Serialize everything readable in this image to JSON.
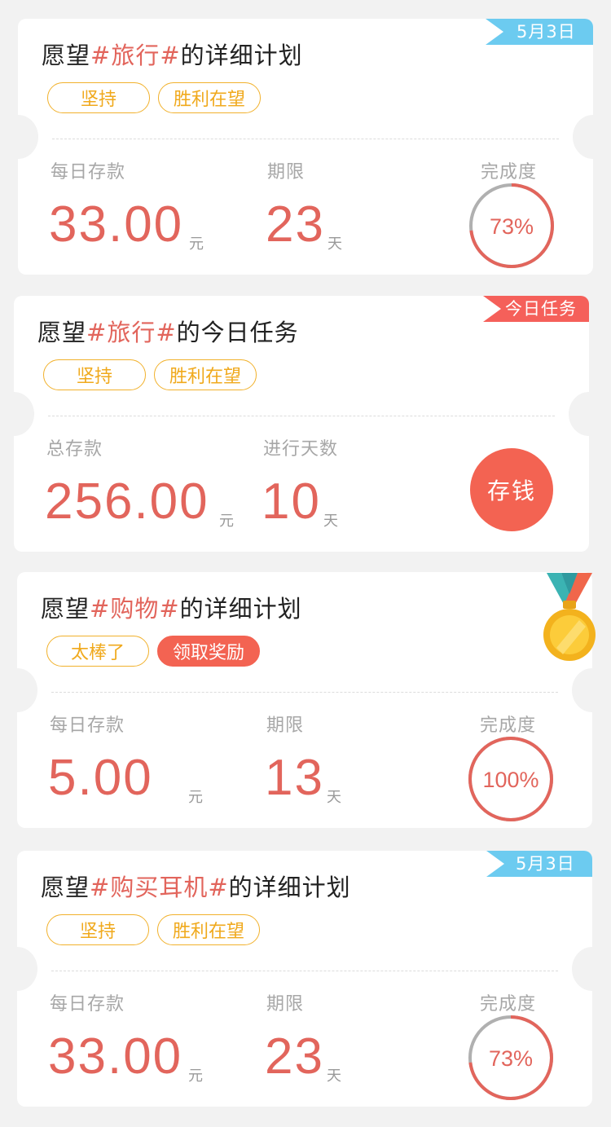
{
  "colors": {
    "accent": "#e2655c",
    "tag_border": "#f1b12c",
    "action": "#f36352",
    "ribbon_blue": "#6ccbf0",
    "ribbon_red": "#f5605a",
    "ring_track": "#b0b0b0"
  },
  "cards": [
    {
      "title_prefix": "愿望",
      "title_tag": "#旅行#",
      "title_suffix": "的详细计划",
      "badge": "5月3日",
      "tags": [
        "坚持",
        "胜利在望"
      ],
      "stat1_label": "每日存款",
      "stat1_value": "33.00",
      "stat1_unit": "元",
      "stat2_label": "期限",
      "stat2_value": "23",
      "stat2_unit": "天",
      "progress_label": "完成度",
      "progress_text": "73%",
      "progress": 0.73
    },
    {
      "title_prefix": "愿望",
      "title_tag": "#旅行#",
      "title_suffix": "的今日任务",
      "badge": "今日任务",
      "tags": [
        "坚持",
        "胜利在望"
      ],
      "stat1_label": "总存款",
      "stat1_value": "256.00",
      "stat1_unit": "元",
      "stat2_label": "进行天数",
      "stat2_value": "10",
      "stat2_unit": "天",
      "action_label": "存钱"
    },
    {
      "title_prefix": "愿望",
      "title_tag": "#购物#",
      "title_suffix": "的详细计划",
      "tags": [
        "太棒了",
        "领取奖励"
      ],
      "stat1_label": "每日存款",
      "stat1_value": "5.00",
      "stat1_unit": "元",
      "stat2_label": "期限",
      "stat2_value": "13",
      "stat2_unit": "天",
      "progress_label": "完成度",
      "progress_text": "100%",
      "progress": 1.0,
      "icon": "medal-icon"
    },
    {
      "title_prefix": "愿望",
      "title_tag": "#购买耳机#",
      "title_suffix": "的详细计划",
      "badge": "5月3日",
      "tags": [
        "坚持",
        "胜利在望"
      ],
      "stat1_label": "每日存款",
      "stat1_value": "33.00",
      "stat1_unit": "元",
      "stat2_label": "期限",
      "stat2_value": "23",
      "stat2_unit": "天",
      "progress_label": "完成度",
      "progress_text": "73%",
      "progress": 0.73
    }
  ]
}
